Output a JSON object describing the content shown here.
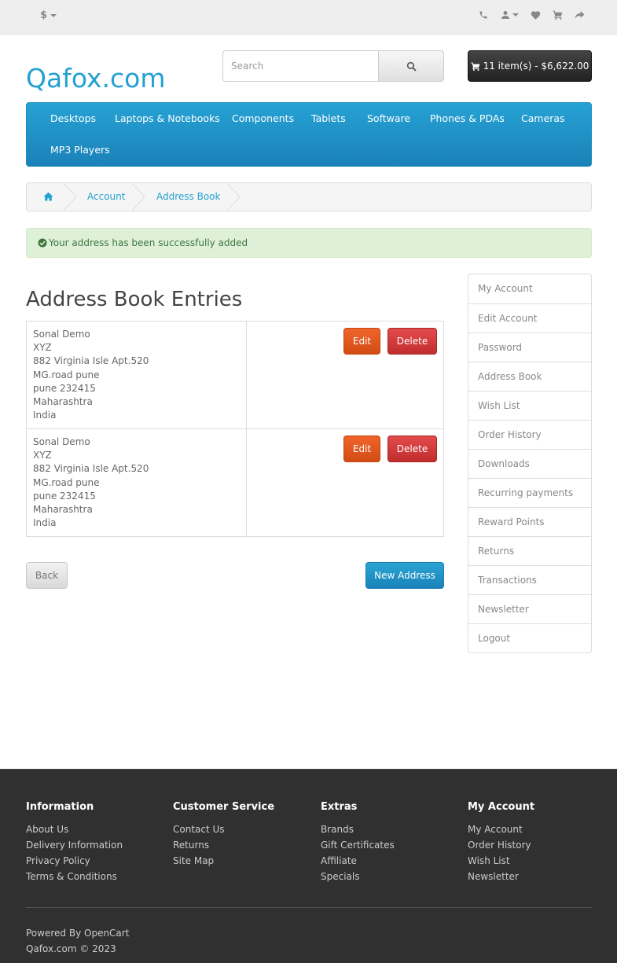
{
  "topbar": {
    "currency": "$",
    "icons": [
      "phone-icon",
      "user-icon",
      "heart-icon",
      "shopping-cart-icon",
      "share-icon"
    ]
  },
  "header": {
    "logo": "Qafox.com",
    "search_placeholder": "Search",
    "cart_label": "11 item(s) - $6,622.00"
  },
  "menu": {
    "items": [
      "Desktops",
      "Laptops & Notebooks",
      "Components",
      "Tablets",
      "Software",
      "Phones & PDAs",
      "Cameras",
      "MP3 Players"
    ]
  },
  "breadcrumb": {
    "items": [
      "Account",
      "Address Book"
    ]
  },
  "alert": {
    "text": "Your address has been successfully added"
  },
  "main": {
    "title": "Address Book Entries",
    "addresses": [
      {
        "lines": [
          "Sonal Demo",
          "XYZ",
          "882 Virginia Isle Apt.520",
          "MG.road pune",
          "pune 232415",
          "Maharashtra",
          "India"
        ]
      },
      {
        "lines": [
          "Sonal Demo",
          "XYZ",
          "882 Virginia Isle Apt.520",
          "MG.road pune",
          "pune 232415",
          "Maharashtra",
          "India"
        ]
      }
    ],
    "edit_label": "Edit",
    "delete_label": "Delete",
    "back_label": "Back",
    "new_address_label": "New Address"
  },
  "sidebar": {
    "items": [
      "My Account",
      "Edit Account",
      "Password",
      "Address Book",
      "Wish List",
      "Order History",
      "Downloads",
      "Recurring payments",
      "Reward Points",
      "Returns",
      "Transactions",
      "Newsletter",
      "Logout"
    ]
  },
  "footer": {
    "columns": [
      {
        "heading": "Information",
        "links": [
          "About Us",
          "Delivery Information",
          "Privacy Policy",
          "Terms & Conditions"
        ]
      },
      {
        "heading": "Customer Service",
        "links": [
          "Contact Us",
          "Returns",
          "Site Map"
        ]
      },
      {
        "heading": "Extras",
        "links": [
          "Brands",
          "Gift Certificates",
          "Affiliate",
          "Specials"
        ]
      },
      {
        "heading": "My Account",
        "links": [
          "My Account",
          "Order History",
          "Wish List",
          "Newsletter"
        ]
      }
    ],
    "powered_by": "Powered By",
    "powered_link": "OpenCart",
    "copyright": "Qafox.com © 2023"
  },
  "colors": {
    "brand": "#23a1d1",
    "menu": "#1f90c6",
    "edit": "#e25a1f",
    "delete": "#d33a3a",
    "alert_bg": "#dff0d8",
    "footer_bg": "#303030"
  }
}
